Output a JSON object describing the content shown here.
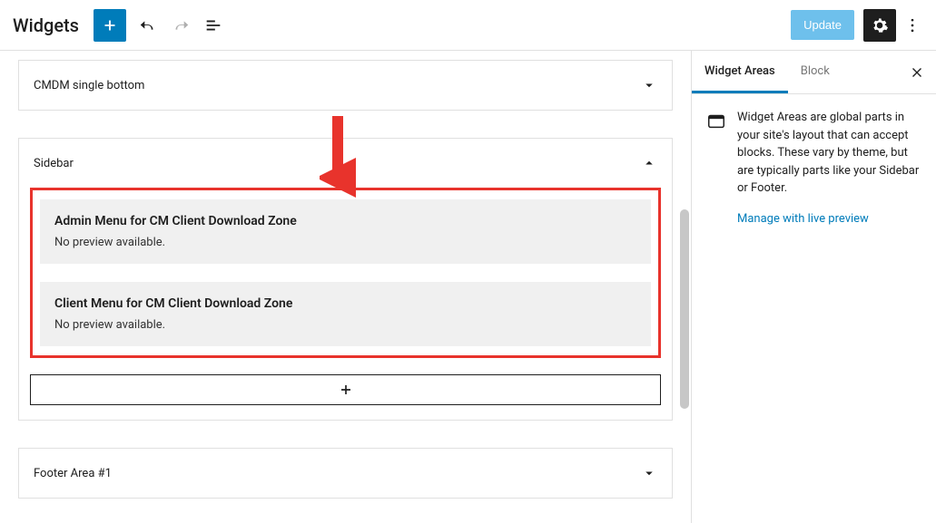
{
  "header": {
    "title": "Widgets",
    "update_label": "Update"
  },
  "areas": {
    "cmsingle": {
      "title": "CMDM single bottom"
    },
    "sidebar": {
      "title": "Sidebar"
    },
    "footer": {
      "title": "Footer Area #1"
    }
  },
  "sidebar_widgets": [
    {
      "title": "Admin Menu for CM Client Download Zone",
      "preview": "No preview available."
    },
    {
      "title": "Client Menu for CM Client Download Zone",
      "preview": "No preview available."
    }
  ],
  "right_panel": {
    "tabs": {
      "areas": "Widget Areas",
      "block": "Block"
    },
    "description": "Widget Areas are global parts in your site's layout that can accept blocks. These vary by theme, but are typically parts like your Sidebar or Footer.",
    "manage_link": "Manage with live preview"
  }
}
